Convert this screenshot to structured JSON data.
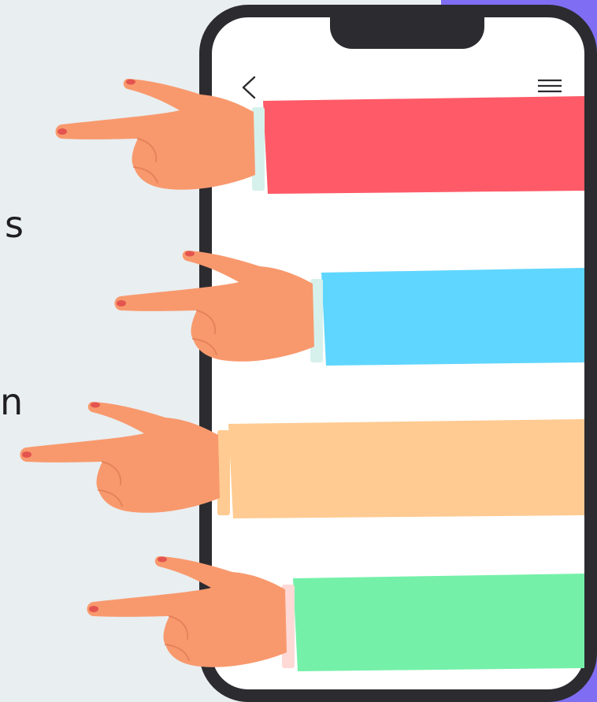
{
  "left_text": {
    "fragment_1": "s",
    "fragment_2": "n,"
  },
  "phone": {
    "back_icon": "chevron-left-icon",
    "menu_icon": "hamburger-menu-icon"
  },
  "colors": {
    "background": "#e9eef0",
    "accent_strip": "#7f6ef3",
    "phone_frame": "#2c2b30",
    "screen": "#ffffff",
    "skin": "#f8996d",
    "skin_shade": "#e5825a",
    "nail": "#e4544f",
    "banners": [
      "#ff5a67",
      "#5fd6ff",
      "#ffcb92",
      "#75f0a9"
    ],
    "cuffs": [
      "#d6f1ec",
      "#d6f1ec",
      "#ffcb92",
      "#ffd9d6"
    ]
  },
  "hands": [
    {
      "color": "#ff5a67",
      "cuff": "#d6f1ec"
    },
    {
      "color": "#5fd6ff",
      "cuff": "#d6f1ec"
    },
    {
      "color": "#ffcb92",
      "cuff": "#ffcb92"
    },
    {
      "color": "#75f0a9",
      "cuff": "#ffd9d6"
    }
  ]
}
